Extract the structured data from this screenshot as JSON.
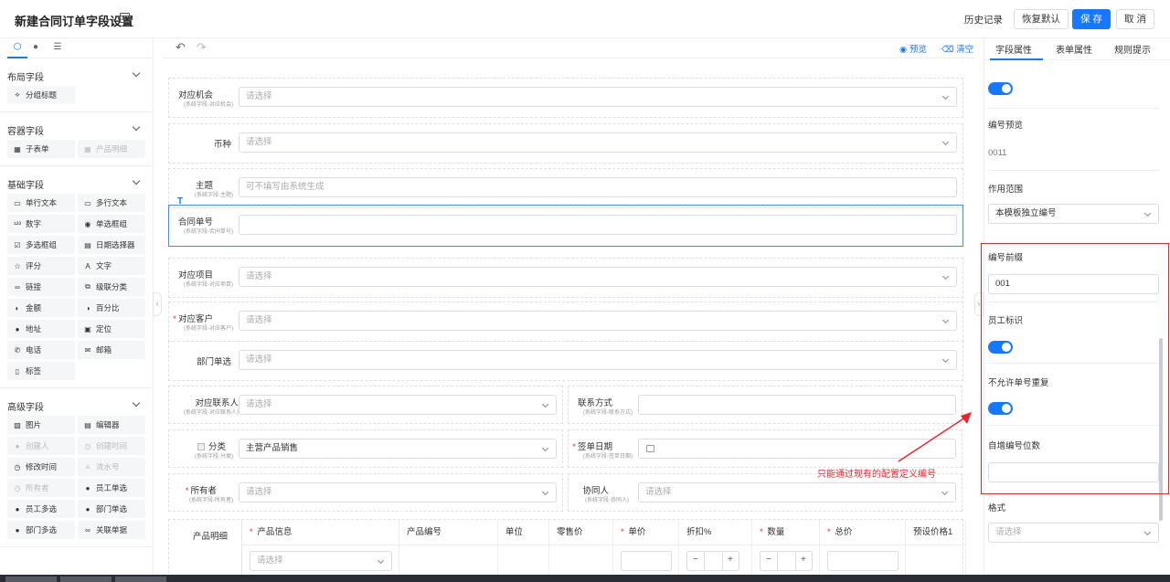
{
  "header": {
    "title": "新建合同订单字段设置",
    "history": "历史记录",
    "restore": "恢复默认",
    "save": "保 存",
    "cancel": "取 消"
  },
  "left": {
    "groups": [
      {
        "title": "布局字段",
        "items": [
          {
            "icon": "group-title-icon",
            "glyph": "⟡",
            "label": "分组标题",
            "disabled": false
          }
        ]
      },
      {
        "title": "容器字段",
        "items": [
          {
            "icon": "table-icon",
            "glyph": "▦",
            "label": "子表单",
            "disabled": false
          },
          {
            "icon": "table-icon",
            "glyph": "▦",
            "label": "产品明细",
            "disabled": true
          }
        ]
      },
      {
        "title": "基础字段",
        "items": [
          {
            "icon": "text-line-icon",
            "glyph": "▭",
            "label": "单行文本",
            "disabled": false
          },
          {
            "icon": "text-multi-icon",
            "glyph": "▭",
            "label": "多行文本",
            "disabled": false
          },
          {
            "icon": "number-icon",
            "glyph": "¹²³",
            "label": "数字",
            "disabled": false
          },
          {
            "icon": "radio-icon",
            "glyph": "◉",
            "label": "单选框组",
            "disabled": false
          },
          {
            "icon": "checkbox-icon",
            "glyph": "☑",
            "label": "多选框组",
            "disabled": false
          },
          {
            "icon": "date-icon",
            "glyph": "▤",
            "label": "日期选择器",
            "disabled": false
          },
          {
            "icon": "star-icon",
            "glyph": "☆",
            "label": "评分",
            "disabled": false
          },
          {
            "icon": "text-icon",
            "glyph": "A",
            "label": "文字",
            "disabled": false
          },
          {
            "icon": "link-icon",
            "glyph": "∞",
            "label": "链接",
            "disabled": false
          },
          {
            "icon": "cascade-icon",
            "glyph": "⧉",
            "label": "级联分类",
            "disabled": false
          },
          {
            "icon": "money-icon",
            "glyph": "◐",
            "label": "金额",
            "disabled": false
          },
          {
            "icon": "percent-icon",
            "glyph": "◑",
            "label": "百分比",
            "disabled": false
          },
          {
            "icon": "location-pin-icon",
            "glyph": "●",
            "label": "地址",
            "disabled": false
          },
          {
            "icon": "locate-icon",
            "glyph": "▣",
            "label": "定位",
            "disabled": false
          },
          {
            "icon": "phone-icon",
            "glyph": "✆",
            "label": "电话",
            "disabled": false
          },
          {
            "icon": "mail-icon",
            "glyph": "✉",
            "label": "邮箱",
            "disabled": false
          },
          {
            "icon": "tag-icon",
            "glyph": "▯",
            "label": "标签",
            "disabled": false
          }
        ]
      },
      {
        "title": "高级字段",
        "items": [
          {
            "icon": "image-icon",
            "glyph": "▧",
            "label": "图片",
            "disabled": false
          },
          {
            "icon": "editor-icon",
            "glyph": "▤",
            "label": "编辑器",
            "disabled": false
          },
          {
            "icon": "user-icon",
            "glyph": "●",
            "label": "创建人",
            "disabled": true
          },
          {
            "icon": "clock-icon",
            "glyph": "◷",
            "label": "创建时间",
            "disabled": true
          },
          {
            "icon": "clock-icon",
            "glyph": "◷",
            "label": "修改时间",
            "disabled": false
          },
          {
            "icon": "serial-icon",
            "glyph": "≡",
            "label": "流水号",
            "disabled": true
          },
          {
            "icon": "clock-icon",
            "glyph": "◷",
            "label": "所有者",
            "disabled": true
          },
          {
            "icon": "user-icon",
            "glyph": "●",
            "label": "员工单选",
            "disabled": false
          },
          {
            "icon": "users-icon",
            "glyph": "●",
            "label": "员工多选",
            "disabled": false
          },
          {
            "icon": "users-icon",
            "glyph": "●",
            "label": "部门单选",
            "disabled": false
          },
          {
            "icon": "users-icon",
            "glyph": "●",
            "label": "部门多选",
            "disabled": false
          },
          {
            "icon": "link-icon",
            "glyph": "∞",
            "label": "关联单据",
            "disabled": false
          }
        ]
      }
    ]
  },
  "center": {
    "preview": "预览",
    "clear": "清空",
    "fields": [
      {
        "label": "对应机会",
        "sub": "(系统字段-对应机会)",
        "value": "请选择",
        "select": true
      },
      {
        "label": "币种",
        "sub": "",
        "value": "请选择",
        "select": true
      },
      {
        "label": "主题",
        "sub": "(系统字段-主题)",
        "value": "可不填写由系统生成",
        "select": false
      },
      {
        "label": "合同单号",
        "sub": "(系统字段-合同单号)",
        "value": "",
        "select": false
      },
      {
        "label": "对应项目",
        "sub": "(系统字段-对应项目)",
        "value": "请选择",
        "select": true
      },
      {
        "label": "对应客户",
        "sub": "(系统字段-对应客户)",
        "value": "请选择",
        "select": true,
        "required": true
      },
      {
        "label": "部门单选",
        "sub": "",
        "value": "请选择",
        "select": true
      }
    ],
    "contact": {
      "label": "对应联系人",
      "sub": "(系统字段-对应联系人)",
      "value": "请选择"
    },
    "contact_method": {
      "label": "联系方式",
      "sub": "(系统字段-联系方式)",
      "value": ""
    },
    "category": {
      "label": "分类",
      "sub": "(系统字段-分类)",
      "value": "主营产品销售"
    },
    "sign_date": {
      "label": "签单日期",
      "sub": "(系统字段-签单日期)",
      "value": ""
    },
    "owner": {
      "label": "所有者",
      "sub": "(系统字段-所有者)",
      "value": "请选择"
    },
    "collaborator": {
      "label": "协同人",
      "sub": "(系统字段-协同人)",
      "value": "请选择"
    },
    "product_detail": {
      "label": "产品明细",
      "columns": [
        "产品信息",
        "产品编号",
        "单位",
        "零售价",
        "单价",
        "折扣%",
        "数量",
        "总价",
        "预设价格1"
      ],
      "required_columns": [
        true,
        false,
        false,
        false,
        true,
        false,
        true,
        true,
        false
      ],
      "select_placeholder": "请选择"
    }
  },
  "right": {
    "tabs": [
      "字段属性",
      "表单属性",
      "规则提示"
    ],
    "number_preview_label": "编号预览",
    "number_preview_value": "0011",
    "scope_label": "作用范围",
    "scope_value": "本模板独立编号",
    "prefix_label": "编号前缀",
    "prefix_value": "001",
    "employee_id_label": "员工标识",
    "no_duplicate_label": "不允许单号重复",
    "increment_digits_label": "自增编号位数",
    "increment_digits_value": "",
    "format_label": "格式",
    "format_placeholder": "请选择"
  },
  "annotation": "只能通过现有的配置定义编号",
  "colors": {
    "accent": "#1677ff",
    "annotation": "#e8262c"
  }
}
